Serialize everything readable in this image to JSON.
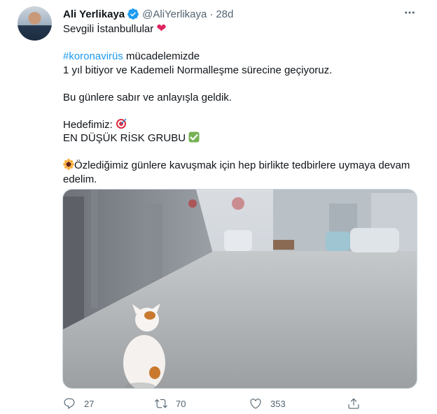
{
  "author": {
    "name": "Ali Yerlikaya",
    "handle": "@AliYerlikaya",
    "separator": "·",
    "time": "28d"
  },
  "tweet": {
    "line1": "Sevgili İstanbullular",
    "hashtag": "#koronavirüs",
    "line2_rest": " mücadelemizde",
    "line3": "1 yıl bitiyor ve Kademeli Normalleşme sürecine geçiyoruz.",
    "line4": "Bu günlere sabır ve anlayışla geldik.",
    "line5": "Hedefimiz: ",
    "line6": "EN DÜŞÜK RİSK GRUBU ",
    "line7": "Özlediğimiz günlere kavuşmak için hep birlikte tedbirlere uymaya devam edelim."
  },
  "actions": {
    "reply_count": "27",
    "retweet_count": "70",
    "like_count": "353"
  },
  "icons": {
    "verified": "verified-badge-icon",
    "more": "more-options-icon",
    "heart_emoji": "red-heart-emoji",
    "target_emoji": "direct-hit-emoji",
    "check_emoji": "check-mark-button-emoji",
    "sunflower_emoji": "sunflower-emoji",
    "reply": "reply-icon",
    "retweet": "retweet-icon",
    "like": "like-icon",
    "share": "share-icon"
  },
  "colors": {
    "accent": "#1d9bf0",
    "secondary_text": "#536471",
    "heart": "#e0245e",
    "check": "#77b255"
  }
}
